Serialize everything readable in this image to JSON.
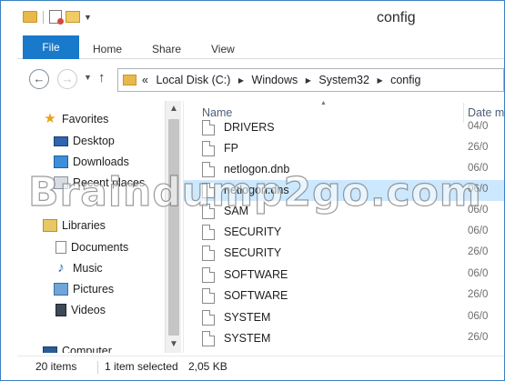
{
  "window": {
    "title": "config"
  },
  "ribbon": {
    "file": "File",
    "home": "Home",
    "share": "Share",
    "view": "View"
  },
  "address": {
    "prefix": "«",
    "crumbs": [
      "Local Disk (C:)",
      "Windows",
      "System32",
      "config"
    ],
    "separator": "▶"
  },
  "nav": {
    "favorites": "Favorites",
    "desktop": "Desktop",
    "downloads": "Downloads",
    "recent": "Recent places",
    "libraries": "Libraries",
    "documents": "Documents",
    "music": "Music",
    "pictures": "Pictures",
    "videos": "Videos",
    "computer": "Computer"
  },
  "columns": {
    "name": "Name",
    "date": "Date m"
  },
  "files": [
    {
      "name": "DRIVERS",
      "date": "04/0"
    },
    {
      "name": "FP",
      "date": "26/0"
    },
    {
      "name": "netlogon.dnb",
      "date": "06/0"
    },
    {
      "name": "netlogon.dns",
      "date": "06/0"
    },
    {
      "name": "SAM",
      "date": "06/0"
    },
    {
      "name": "SECURITY",
      "date": "06/0"
    },
    {
      "name": "SECURITY",
      "date": "26/0"
    },
    {
      "name": "SOFTWARE",
      "date": "06/0"
    },
    {
      "name": "SOFTWARE",
      "date": "26/0"
    },
    {
      "name": "SYSTEM",
      "date": "06/0"
    },
    {
      "name": "SYSTEM",
      "date": "26/0"
    }
  ],
  "status": {
    "items": "20 items",
    "selected": "1 item selected",
    "size": "2,05 KB"
  },
  "watermark": "Braindump2go.com",
  "colors": {
    "file_tab": "#1979ca",
    "selection": "#cce8ff",
    "frame": "#3b7fc4"
  },
  "icons": {
    "favorites": "star-icon",
    "desktop": "desktop-icon",
    "downloads": "downloads-icon",
    "recent": "recent-places-icon",
    "libraries": "libraries-icon",
    "documents": "documents-icon",
    "music": "music-icon",
    "pictures": "pictures-icon",
    "videos": "videos-icon",
    "computer": "computer-icon",
    "file": "file-icon"
  }
}
